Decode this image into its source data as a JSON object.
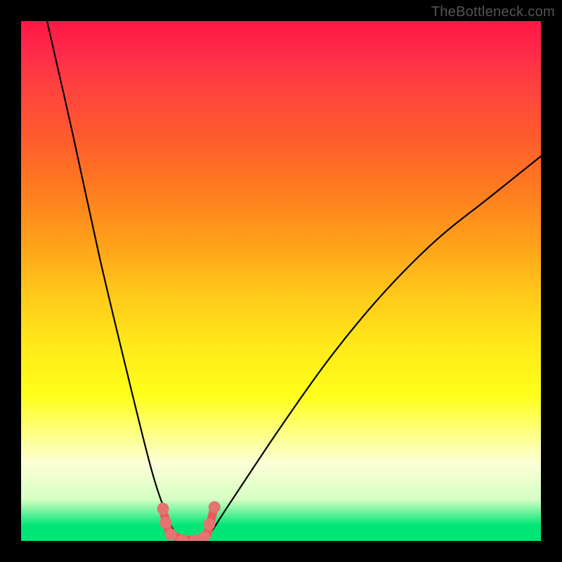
{
  "watermark": "TheBottleneck.com",
  "chart_data": {
    "type": "line",
    "title": "",
    "xlabel": "",
    "ylabel": "",
    "xlim": [
      0,
      100
    ],
    "ylim": [
      0,
      100
    ],
    "series": [
      {
        "name": "bottleneck-curve",
        "x": [
          5,
          10,
          15,
          20,
          25,
          28,
          30,
          32,
          34,
          36,
          40,
          50,
          60,
          70,
          80,
          90,
          100
        ],
        "y": [
          100,
          78,
          55,
          34,
          14,
          5,
          1,
          0,
          0,
          1,
          7,
          22,
          36,
          48,
          58,
          66,
          74
        ]
      }
    ],
    "markers": {
      "name": "highlighted-points",
      "color": "#e57373",
      "stroke_color": "#ec5858",
      "stroke_width": 12,
      "stroke_path_x": [
        27.5,
        28.5,
        31,
        34,
        35.8,
        37
      ],
      "stroke_path_y": [
        5.2,
        1.5,
        0.2,
        0.2,
        1.2,
        5.8
      ],
      "points_x": [
        27.3,
        27.8,
        28.8,
        31,
        33.5,
        35.2,
        36.2,
        37.2
      ],
      "points_y": [
        6.2,
        3.5,
        1.2,
        0.1,
        0.1,
        0.7,
        3.2,
        6.5
      ]
    },
    "background": {
      "type": "vertical-gradient",
      "stops": [
        {
          "pos": 0,
          "color": "#ff1744"
        },
        {
          "pos": 72,
          "color": "#ffff1a"
        },
        {
          "pos": 97,
          "color": "#00e676"
        }
      ]
    }
  }
}
